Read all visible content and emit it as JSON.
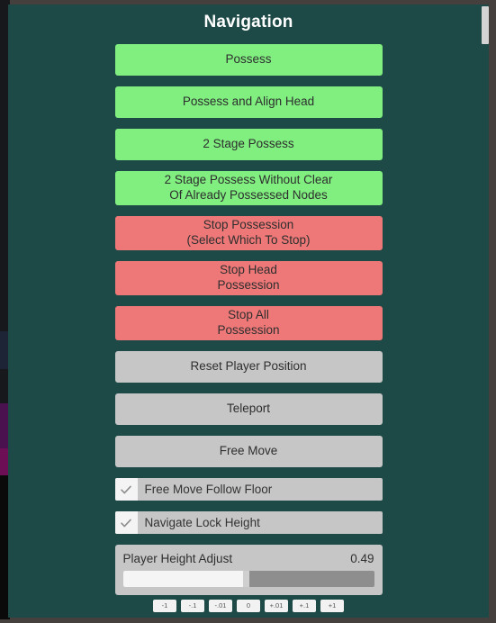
{
  "window": {
    "title": "Navigation",
    "panel_bg": "#1d4a47",
    "outer_bg": "#45403d"
  },
  "actions": [
    {
      "label": "Possess",
      "style": "green",
      "size": "h1"
    },
    {
      "label": "Possess and Align Head",
      "style": "green",
      "size": "h1"
    },
    {
      "label": "2 Stage Possess",
      "style": "green",
      "size": "h1"
    },
    {
      "label": "2 Stage Possess Without Clear\nOf Already Possessed Nodes",
      "style": "green",
      "size": "h2"
    },
    {
      "label": "Stop Possession\n(Select Which To Stop)",
      "style": "red",
      "size": "h2"
    },
    {
      "label": "Stop Head\nPossession",
      "style": "red",
      "size": "h2"
    },
    {
      "label": "Stop All\nPossession",
      "style": "red",
      "size": "h2"
    },
    {
      "label": "Reset Player Position",
      "style": "grey",
      "size": "h1"
    },
    {
      "label": "Teleport",
      "style": "grey",
      "size": "h1"
    },
    {
      "label": "Free Move",
      "style": "grey",
      "size": "h1"
    }
  ],
  "checkboxes": [
    {
      "label": "Free Move Follow Floor",
      "checked": true
    },
    {
      "label": "Navigate Lock Height",
      "checked": true
    }
  ],
  "slider": {
    "label": "Player Height Adjust",
    "value": "0.49",
    "fill_percent": 49,
    "steps": [
      "-1",
      "-.1",
      "-.01",
      "0",
      "+.01",
      "+.1",
      "+1"
    ]
  },
  "colors": {
    "green": "#80ef80",
    "red": "#ee7878",
    "grey": "#c6c6c6",
    "panel": "#1d4a47"
  }
}
